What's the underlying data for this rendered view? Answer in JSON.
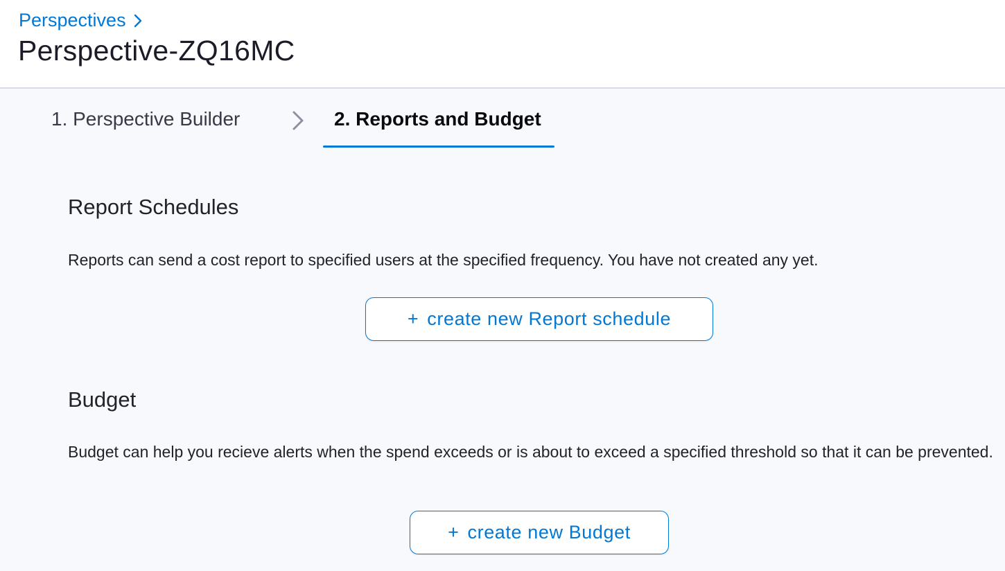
{
  "header": {
    "breadcrumb": "Perspectives",
    "title": "Perspective-ZQ16MC"
  },
  "tabs": [
    {
      "label": "1. Perspective Builder",
      "active": false
    },
    {
      "label": "2. Reports and Budget",
      "active": true
    }
  ],
  "report_schedules": {
    "title": "Report Schedules",
    "description": "Reports can send a cost report to specified users at the specified frequency. You have not created any yet.",
    "button_plus": "+",
    "button_label": "create new Report schedule"
  },
  "budget": {
    "title": "Budget",
    "description": "Budget can help you recieve alerts when the spend exceeds or is about to exceed a specified threshold so that it can be prevented.",
    "button_plus": "+",
    "button_label": "create new Budget"
  },
  "colors": {
    "accent": "#0278d5",
    "background": "#f8f9fc",
    "header_bg": "#ffffff"
  }
}
